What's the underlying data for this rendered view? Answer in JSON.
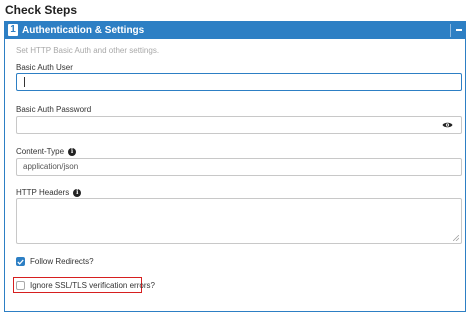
{
  "page": {
    "title": "Check Steps"
  },
  "panel": {
    "step_number": "1",
    "title": "Authentication & Settings",
    "description": "Set HTTP Basic Auth and other settings.",
    "collapse_icon": "minus-icon"
  },
  "fields": {
    "basic_auth_user": {
      "label": "Basic Auth User",
      "value": ""
    },
    "basic_auth_password": {
      "label": "Basic Auth Password",
      "value": "",
      "toggle_icon": "eye-icon"
    },
    "content_type": {
      "label": "Content-Type",
      "value": "application/json",
      "info_icon": "info-icon"
    },
    "http_headers": {
      "label": "HTTP Headers",
      "value": "",
      "info_icon": "info-icon"
    }
  },
  "options": {
    "follow_redirects": {
      "label": "Follow Redirects?",
      "checked": true
    },
    "ignore_ssl": {
      "label": "Ignore SSL/TLS verification errors?",
      "checked": false
    }
  },
  "colors": {
    "accent": "#2d7fc4",
    "highlight": "#d61f1f"
  }
}
